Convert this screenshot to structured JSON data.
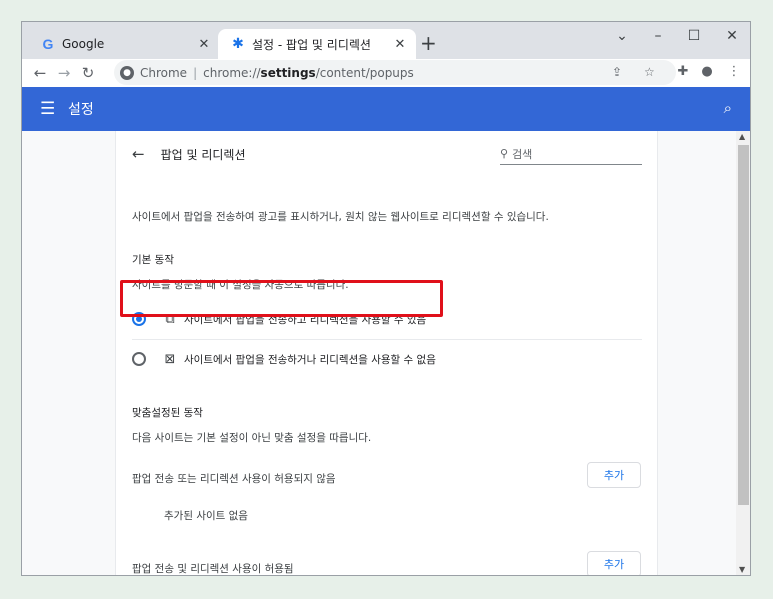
{
  "tabs": [
    {
      "title": "Google",
      "icon": "google-g-icon"
    },
    {
      "title": "설정 - 팝업 및 리디렉션",
      "icon": "settings-gear-icon"
    }
  ],
  "window_controls": {
    "tab_search": "⌄",
    "minimize": "–",
    "maximize": "☐",
    "close": "✕"
  },
  "toolbar": {
    "chrome_label": "Chrome",
    "url_scheme": "chrome://",
    "url_host": "settings",
    "url_path": "/content/popups"
  },
  "header": {
    "title": "설정"
  },
  "page": {
    "subpage_title": "팝업 및 리디렉션",
    "search_placeholder": "검색",
    "description": "사이트에서 팝업을 전송하여 광고를 표시하거나, 원치 않는 웹사이트로 리디렉션할 수 있습니다.",
    "default_behavior_heading": "기본 동작",
    "default_behavior_desc": "사이트를 방문할 때 이 설정을 자동으로 따릅니다.",
    "option_allow": "사이트에서 팝업을 전송하고 리디렉션을 사용할 수 있음",
    "option_block": "사이트에서 팝업을 전송하거나 리디렉션을 사용할 수 없음",
    "selected_option": "allow",
    "custom_heading": "맞춤설정된 동작",
    "custom_desc": "다음 사이트는 기본 설정이 아닌 맞춤 설정을 따릅니다.",
    "block_list_label": "팝업 전송 또는 리디렉션 사용이 허용되지 않음",
    "block_add_button": "추가",
    "no_sites_added": "추가된 사이트 없음",
    "allow_list_label": "팝업 전송 및 리디렉션 사용이 허용됨",
    "allow_add_button": "추가"
  },
  "colors": {
    "header_blue": "#3367d6",
    "accent": "#1a73e8",
    "highlight_red": "#e0101a"
  }
}
